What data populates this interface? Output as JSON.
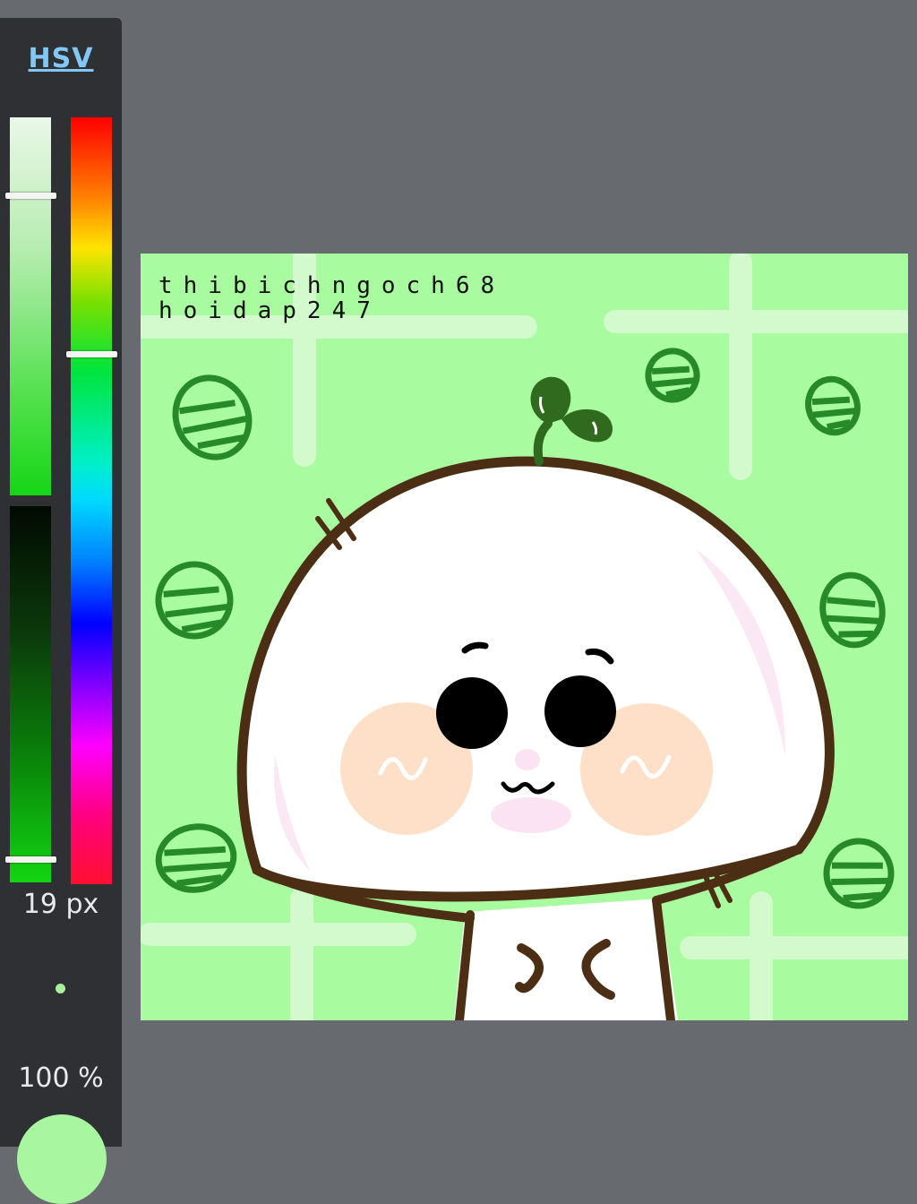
{
  "color_panel": {
    "mode_label": "HSV",
    "brush_size": "19 px",
    "opacity": "100 %",
    "current_color": "#a9f6a0",
    "value_level_fraction": 0.25,
    "hue_level_fraction": 0.33
  },
  "canvas": {
    "watermark_line1": "thibichngoch68",
    "watermark_line2": "hoidap247",
    "background_color": "#a9fb9f"
  }
}
